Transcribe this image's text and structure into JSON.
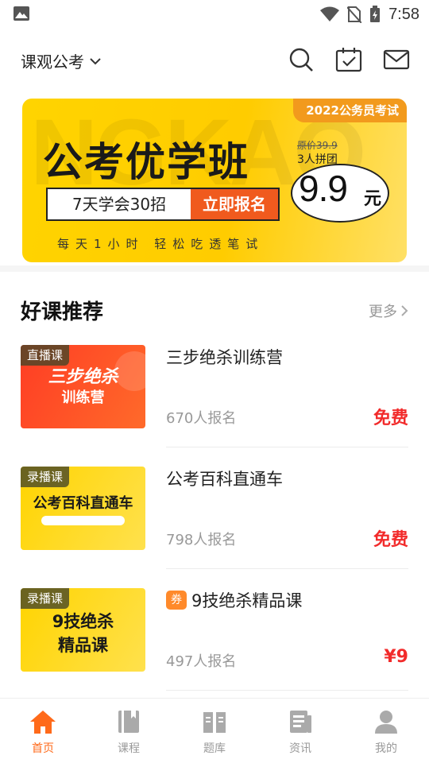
{
  "status_bar": {
    "time": "7:58"
  },
  "header": {
    "selector_label": "课观公考",
    "icons": [
      "search-icon",
      "calendar-check-icon",
      "mail-icon"
    ]
  },
  "banner": {
    "ghost_text": "NGKAO",
    "corner_tag": "2022公务员考试",
    "title": "公考优学班",
    "sub_left": "7天学会30招",
    "sub_right": "立即报名",
    "slogan": "每天1小时 轻松吃透笔试",
    "price_original": "原价39.9",
    "price_group": "3人拼团",
    "price": "9.9",
    "price_unit": "元"
  },
  "section": {
    "title": "好课推荐",
    "more_label": "更多"
  },
  "courses": [
    {
      "tag": "直播课",
      "name": "三步绝杀训练营",
      "count": "670人报名",
      "price": "免费",
      "thumb_line1": "三步绝杀",
      "thumb_line2": "训练营",
      "coupon": ""
    },
    {
      "tag": "录播课",
      "name": "公考百科直通车",
      "count": "798人报名",
      "price": "免费",
      "thumb_line1": "公考百科直通车",
      "thumb_line2": "",
      "coupon": ""
    },
    {
      "tag": "录播课",
      "name": "9技绝杀精品课",
      "count": "497人报名",
      "price": "¥9",
      "thumb_line1": "9技绝杀",
      "thumb_line2": "精品课",
      "coupon": "券"
    }
  ],
  "bottom_nav": [
    {
      "label": "首页",
      "icon": "home-icon",
      "active": true
    },
    {
      "label": "课程",
      "icon": "course-book-icon",
      "active": false
    },
    {
      "label": "题库",
      "icon": "question-bank-icon",
      "active": false
    },
    {
      "label": "资讯",
      "icon": "news-icon",
      "active": false
    },
    {
      "label": "我的",
      "icon": "profile-icon",
      "active": false
    }
  ],
  "colors": {
    "accent": "#ff6a1a",
    "price": "#f22b2b",
    "banner": "#ffd400"
  }
}
